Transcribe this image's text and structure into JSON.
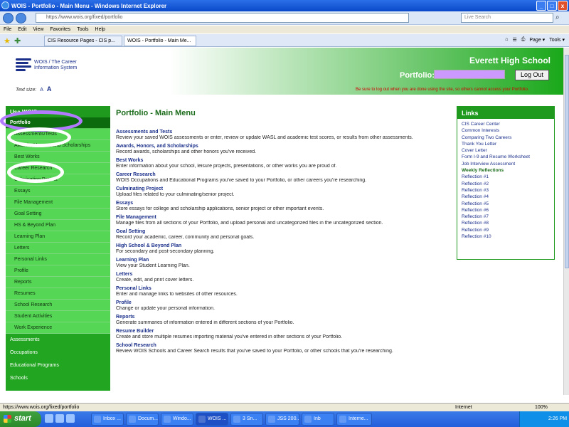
{
  "window": {
    "title": "WOIS - Portfolio - Main Menu - Windows Internet Explorer",
    "close": "x",
    "minimize": "_",
    "maximize": "□"
  },
  "address_bar": {
    "url": "https://www.wois.org/fixed/portfolio",
    "search_placeholder": "Live Search"
  },
  "menu": [
    "File",
    "Edit",
    "View",
    "Favorites",
    "Tools",
    "Help"
  ],
  "tabs": [
    {
      "label": "CIS Resource Pages - CIS p..."
    },
    {
      "label": "WOIS - Portfolio - Main Me..."
    }
  ],
  "toolbar": {
    "page_label": "Page ▾",
    "tools_label": "Tools ▾"
  },
  "site": {
    "logo_line1": "WOIS / The Career",
    "logo_line2": "Information System",
    "text_size_label": "Text size:",
    "text_size_small": "A",
    "text_size_large": "A",
    "school": "Everett High School",
    "portfolio_label": "Portfolio:",
    "logout": "Log Out",
    "logout_note": "Be sure to log out when you are done using the site, so others cannot access your Portfolio."
  },
  "leftnav": {
    "header": "Use WOIS",
    "active": "Portfolio",
    "subitems": [
      "Assessments/Tests",
      "Awards, Honors, and Scholarships",
      "Best Works",
      "Career Research",
      "Culminating Project",
      "Essays",
      "File Management",
      "Goal Setting",
      "HS & Beyond Plan",
      "Learning Plan",
      "Letters",
      "Personal Links",
      "Profile",
      "Reports",
      "Resumes",
      "School Research",
      "Student Activities",
      "Work Experience"
    ],
    "main_items": [
      "Assessments",
      "Occupations",
      "Educational Programs",
      "Schools"
    ]
  },
  "main": {
    "title": "Portfolio - Main Menu",
    "entries": [
      {
        "title": "Assessments and Tests",
        "desc": "Review your saved WOIS assessments or enter, review or update WASL and academic test scores, or results from other assessments."
      },
      {
        "title": "Awards, Honors, and Scholarships",
        "desc": "Record awards, scholarships and other honors you've received."
      },
      {
        "title": "Best Works",
        "desc": "Enter information about your school, leisure projects, presentations, or other works you are proud of."
      },
      {
        "title": "Career Research",
        "desc": "WOIS Occupations and Educational Programs you've saved to your Portfolio, or other careers you're researching."
      },
      {
        "title": "Culminating Project",
        "desc": "Upload files related to your culminating/senior project."
      },
      {
        "title": "Essays",
        "desc": "Store essays for college and scholarship applications, senior project or other important events."
      },
      {
        "title": "File Management",
        "desc": "Manage files from all sections of your Portfolio, and upload personal and uncategorized files in the uncategorized section."
      },
      {
        "title": "Goal Setting",
        "desc": "Record your academic, career, community and personal goals."
      },
      {
        "title": "High School & Beyond Plan",
        "desc": "For secondary and post-secondary planning."
      },
      {
        "title": "Learning Plan",
        "desc": "View your Student Learning Plan."
      },
      {
        "title": "Letters",
        "desc": "Create, edit, and print cover letters."
      },
      {
        "title": "Personal Links",
        "desc": "Enter and manage links to websites of other resources."
      },
      {
        "title": "Profile",
        "desc": "Change or update your personal information."
      },
      {
        "title": "Reports",
        "desc": "Generate summaries of information entered in different sections of your Portfolio."
      },
      {
        "title": "Resume Builder",
        "desc": "Create and store multiple resumes importing material you've entered in other sections of your Portfolio."
      },
      {
        "title": "School Research",
        "desc": "Review WOIS Schools and Career Search results that you've saved to your Portfolio, or other schools that you're researching."
      }
    ]
  },
  "links": {
    "header": "Links",
    "items": [
      "CIS Career Center",
      "Common Interests",
      "Comparing Two Careers",
      "Thank You Letter",
      "Cover Letter",
      "Form I-9 and Resume Worksheet",
      "Job Interview Assessment"
    ],
    "reflections_label": "Weekly Reflections",
    "reflections": [
      "Reflection #1",
      "Reflection #2",
      "Reflection #3",
      "Reflection #4",
      "Reflection #5",
      "Reflection #6",
      "Reflection #7",
      "Reflection #8",
      "Reflection #9",
      "Reflection #10"
    ]
  },
  "status": {
    "url": "https://www.wois.org/fixed/portfolio",
    "zone": "Internet",
    "zoom": "100%"
  },
  "taskbar": {
    "start": "start",
    "buttons": [
      "Inbox ...",
      "Docum...",
      "Windo...",
      "WOIS ...",
      "3 Sn...",
      "JSS 200...",
      "Inb",
      "Interne..."
    ],
    "clock": "2:26 PM"
  },
  "colors": {
    "nav_green": "#22a622",
    "header_green": "#1aa81a",
    "link_blue": "#1a2f8a",
    "highlight_white": "#ffffff",
    "highlight_purple": "#b27bff",
    "portfolio_box": "#cc99ff"
  }
}
